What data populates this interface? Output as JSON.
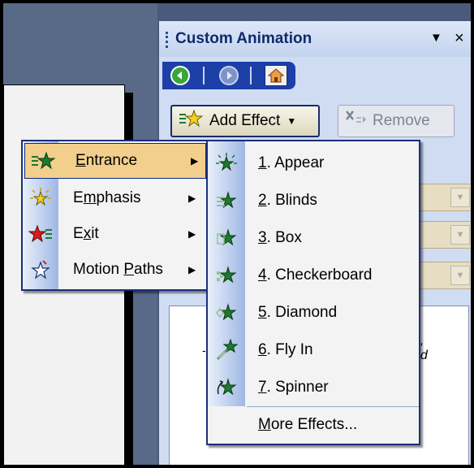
{
  "task_pane": {
    "title": "Custom Animation",
    "dropdown_glyph": "▼",
    "close_glyph": "×"
  },
  "nav": {
    "back_icon": "back-arrow-icon",
    "forward_icon": "forward-arrow-icon",
    "home_icon": "home-icon"
  },
  "toolbar": {
    "add_effect_label": "Add Effect",
    "remove_label": "Remove"
  },
  "fragments": {
    "line1": "e,",
    "line2": "dd"
  },
  "effect_menu": {
    "items": [
      {
        "key": "E",
        "rest": "ntrance",
        "icon": "green-star-icon",
        "selected": true
      },
      {
        "key": "",
        "pre": "E",
        "key2": "m",
        "rest": "phasis",
        "icon": "yellow-star-icon"
      },
      {
        "pre": "E",
        "key": "x",
        "rest": "it",
        "icon": "red-star-icon"
      },
      {
        "pre": "Motion ",
        "key": "P",
        "rest": "aths",
        "icon": "outline-star-icon"
      }
    ]
  },
  "entrance_menu": {
    "items": [
      {
        "num": "1",
        "label": ". Appear"
      },
      {
        "num": "2",
        "label": ". Blinds"
      },
      {
        "num": "3",
        "label": ". Box"
      },
      {
        "num": "4",
        "label": ". Checkerboard"
      },
      {
        "num": "5",
        "label": ". Diamond"
      },
      {
        "num": "6",
        "label": ". Fly In"
      },
      {
        "num": "7",
        "label": ". Spinner"
      }
    ],
    "more_key": "M",
    "more_rest": "ore Effects..."
  },
  "colors": {
    "menu_highlight": "#f2cf8c",
    "menu_border": "#1b2e7a",
    "star_green": "#1e7a2c",
    "star_yellow": "#f2d21e",
    "star_red": "#d81c1c"
  }
}
